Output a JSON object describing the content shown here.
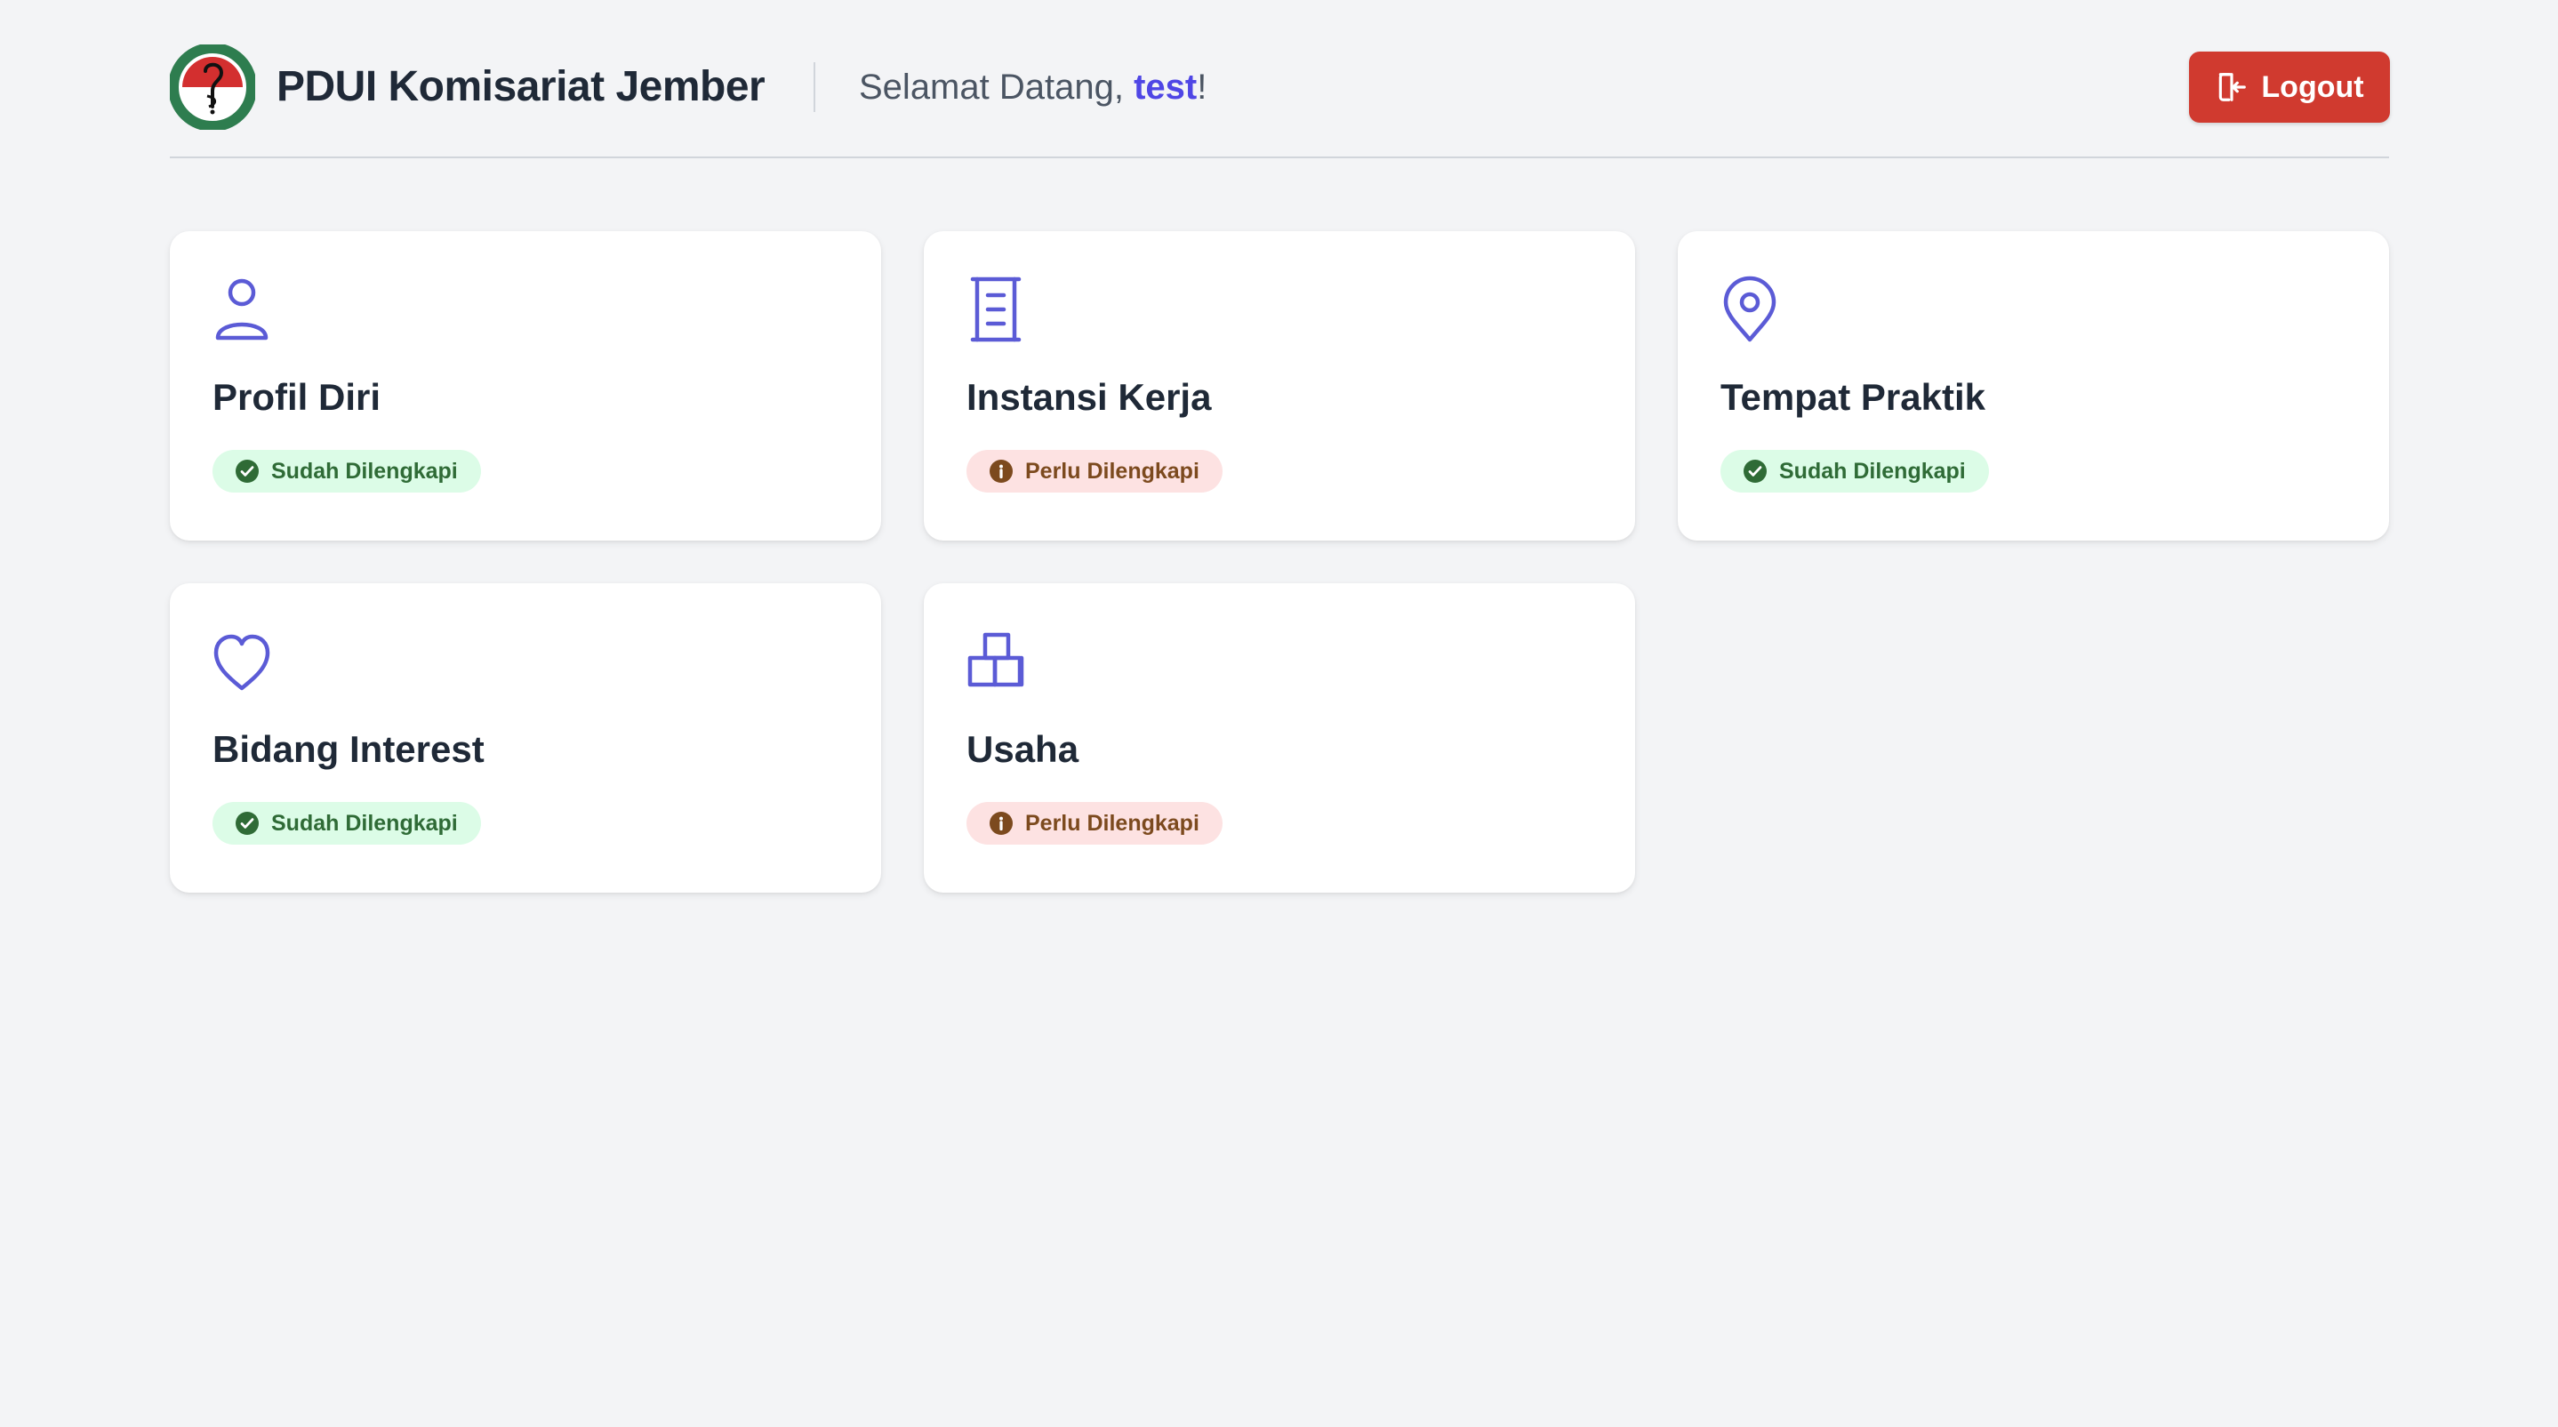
{
  "header": {
    "app_title": "PDUI Komisariat Jember",
    "greeting_prefix": "Selamat Datang, ",
    "username": "test",
    "greeting_suffix": "!",
    "logout_label": "Logout",
    "logout_color": "#d03a2f",
    "logout_icon": "logout-icon",
    "logo": "pdui-logo"
  },
  "accent_color": "#5b5bd6",
  "cards": [
    {
      "title": "Profil Diri",
      "icon": "user-icon",
      "status": "Sudah Dilengkapi",
      "status_type": "complete"
    },
    {
      "title": "Instansi Kerja",
      "icon": "building-icon",
      "status": "Perlu Dilengkapi",
      "status_type": "incomplete"
    },
    {
      "title": "Tempat Praktik",
      "icon": "map-pin-icon",
      "status": "Sudah Dilengkapi",
      "status_type": "complete"
    },
    {
      "title": "Bidang Interest",
      "icon": "heart-icon",
      "status": "Sudah Dilengkapi",
      "status_type": "complete"
    },
    {
      "title": "Usaha",
      "icon": "boxes-icon",
      "status": "Perlu Dilengkapi",
      "status_type": "incomplete"
    }
  ],
  "status_colors": {
    "complete_bg": "#dcfce7",
    "complete_text": "#2f6b36",
    "incomplete_bg": "#fde2e2",
    "incomplete_text": "#7c4a1e"
  }
}
